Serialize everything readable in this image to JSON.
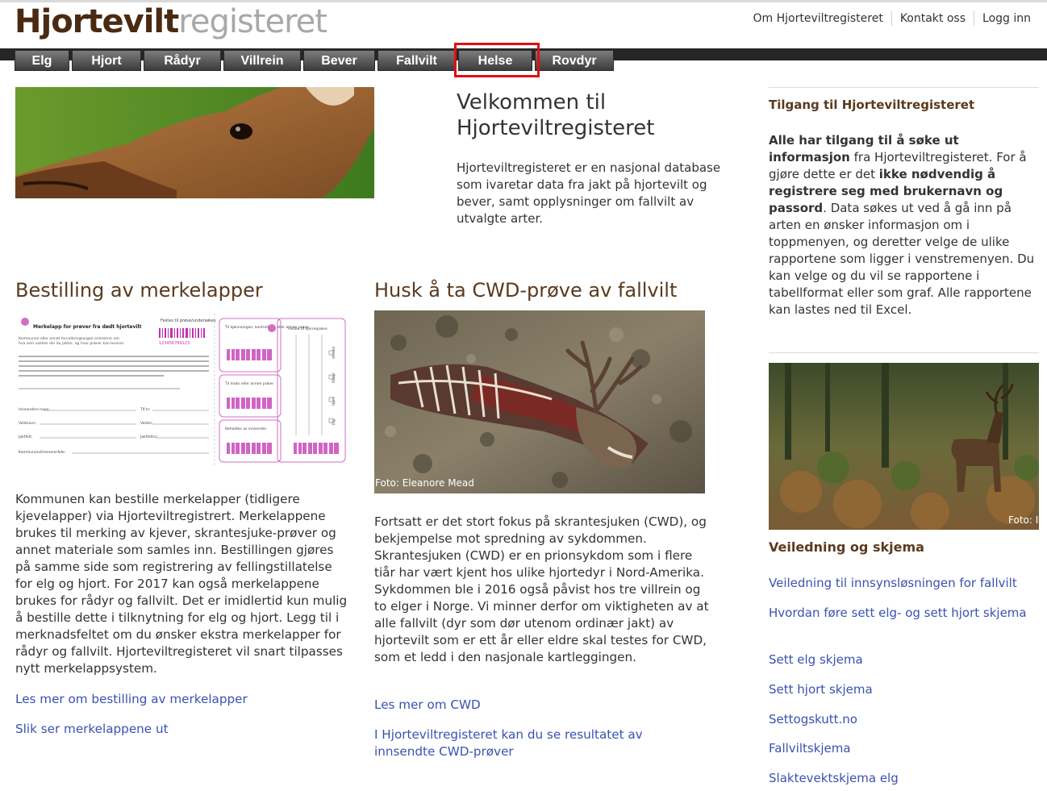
{
  "header": {
    "logo_part1": "Hjortevilt",
    "logo_part2": "registeret",
    "links": [
      "Om Hjorteviltregisteret",
      "Kontakt oss",
      "Logg inn"
    ]
  },
  "nav": [
    "Elg",
    "Hjort",
    "Rådyr",
    "Villrein",
    "Bever",
    "Fallvilt",
    "Helse",
    "Rovdyr"
  ],
  "welcome": {
    "title": "Velkommen til Hjorteviltregisteret",
    "text": "Hjorteviltregisteret er en nasjonal database som ivaretar data fra jakt på hjortevilt og bever, samt opplysninger om fallvilt av utvalgte arter."
  },
  "merkelapper": {
    "title": "Bestilling av merkelapper",
    "text": "Kommunen kan bestille merkelapper (tidligere kjevelapper) via Hjorteviltregistrert. Merkelappene brukes til merking av kjever, skrantesjuke-prøver og annet materiale som samles inn. Bestillingen gjøres på samme side som registrering av fellingstillatelse for elg og hjort. For 2017 kan også merkelappene brukes for rådyr og fallvilt. Det er imidlertid kun mulig å bestille dette i tilknytning for elg og hjort. Legg til i merknadsfeltet om du ønsker ekstra merkelapper for rådyr og fallvilt. Hjorteviltregisteret vil snart tilpasses nytt merkelappsystem.",
    "link1": "Les mer om bestilling av merkelapper",
    "link2": "Slik ser merkelappene ut",
    "label_card": {
      "heading": "Merkelapp for prøver fra dødt hjortevilt",
      "tested_for": "Festes til prøve/undersøkes",
      "line1": "Kommunen eller annet forvaltningsorgan orienterer om",
      "line2": "hva som samles der du jakter, og hvor prøver kan leveres",
      "barcode": "123456789123",
      "fields": [
        "Innsenders navn:",
        "Valdnavn:",
        "Jaktfelt:",
        "Kommune/villreinområde:"
      ],
      "fields_right": [
        "Tlf.nr:",
        "Valdnr:",
        "Jaktfeltnr:"
      ],
      "boxes": [
        "Til kjønnsorgan, kontrollkort eller annen prøve",
        "Til moks eller annen prøve",
        "Beholdes av innsender",
        "Festes til hjerneprøve"
      ],
      "species": [
        "Villrein",
        "Rådyr",
        "Hjort",
        "Elg"
      ]
    }
  },
  "cwd": {
    "title": "Husk å ta CWD-prøve av fallvilt",
    "photo_credit": "Foto: Eleanore Mead",
    "text": "Fortsatt er det stort fokus på skrantesjuken (CWD), og bekjempelse mot spredning av sykdommen. Skrantesjuken (CWD) er en prionsykdom som i flere tiår har vært kjent hos ulike hjortedyr i Nord-Amerika. Sykdommen ble i 2016 også påvist hos tre villrein og to elger i Norge. Vi minner derfor om viktigheten av at alle fallvilt (dyr som dør utenom ordinær jakt) av hjortevilt som er ett år eller eldre skal testes for CWD, som et ledd i den nasjonale kartleggingen.",
    "link1": "Les mer om CWD",
    "link2": "I Hjorteviltregisteret kan du se resultatet av innsendte CWD-prøver"
  },
  "sidebar": {
    "access_title": "Tilgang til Hjorteviltregisteret",
    "access_bold1": "Alle har tilgang til å søke ut informasjon",
    "access_text1": " fra Hjorteviltregisteret. For å gjøre dette er det ",
    "access_bold2": "ikke nødvendig å registrere seg med brukernavn og passord",
    "access_text2": ". Data søkes ut ved å gå inn på arten en ønsker informasjon om i toppmenyen, og deretter velge de ulike rapportene som ligger i venstremenyen. Du kan velge og du vil se rapportene i tabellformat eller som graf. Alle rapportene kan lastes ned til Excel.",
    "photo_credit": "Foto: I",
    "guide_title": "Veiledning og skjema",
    "links": [
      "Veiledning til innsynsløsningen for fallvilt",
      "Hvordan føre sett elg- og sett hjort skjema",
      "Sett elg skjema",
      "Sett hjort skjema",
      "Settogskutt.no",
      "Fallviltskjema",
      "Slaktevektskjema elg"
    ]
  }
}
